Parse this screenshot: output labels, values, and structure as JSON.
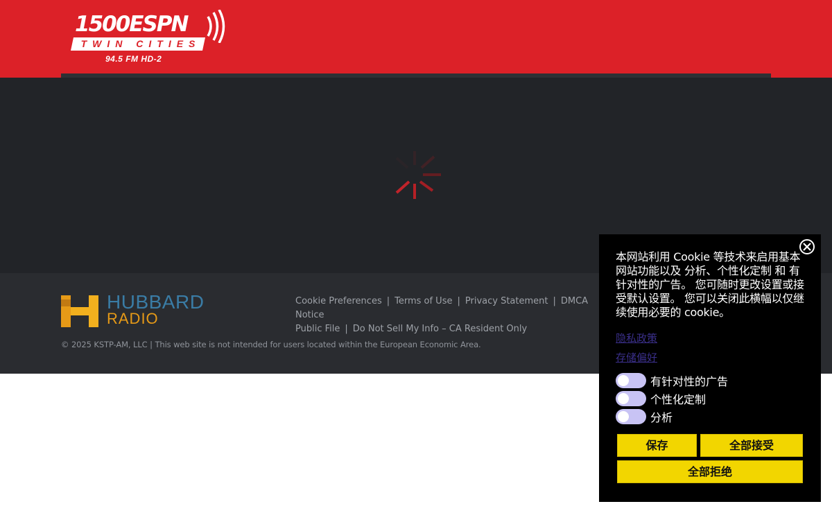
{
  "header": {
    "logo_main": "1500ESPN",
    "logo_band": "TWIN CITIES",
    "logo_sub": "94.5 FM HD-2",
    "bg_color": "#dc2128"
  },
  "main": {
    "loading_icon": "spinner-icon"
  },
  "footer": {
    "brand_top": "HUBBARD",
    "brand_bottom": "RADIO",
    "links": [
      "Cookie Preferences",
      "Terms of Use",
      "Privacy Statement",
      "DMCA Notice",
      "Public File",
      "Do Not Sell My Info – CA Resident Only"
    ],
    "copyright": "© 2025 KSTP-AM, LLC | This web site is not intended for users located within the European Economic Area."
  },
  "cookie_banner": {
    "text": "本网站利用 Cookie 等技术来启用基本网站功能以及 分析、个性化定制 和 有针对性的广告。 您可随时更改设置或接受默认设置。 您可以关闭此横幅以仅继续使用必要的 cookie。",
    "privacy_link": "隐私政策",
    "storage_link": "存储偏好",
    "toggles": [
      {
        "label": "有针对性的广告",
        "on": false
      },
      {
        "label": "个性化定制",
        "on": false
      },
      {
        "label": "分析",
        "on": false
      }
    ],
    "save_label": "保存",
    "accept_all_label": "全部接受",
    "reject_all_label": "全部拒绝",
    "button_color": "#f2d600"
  }
}
